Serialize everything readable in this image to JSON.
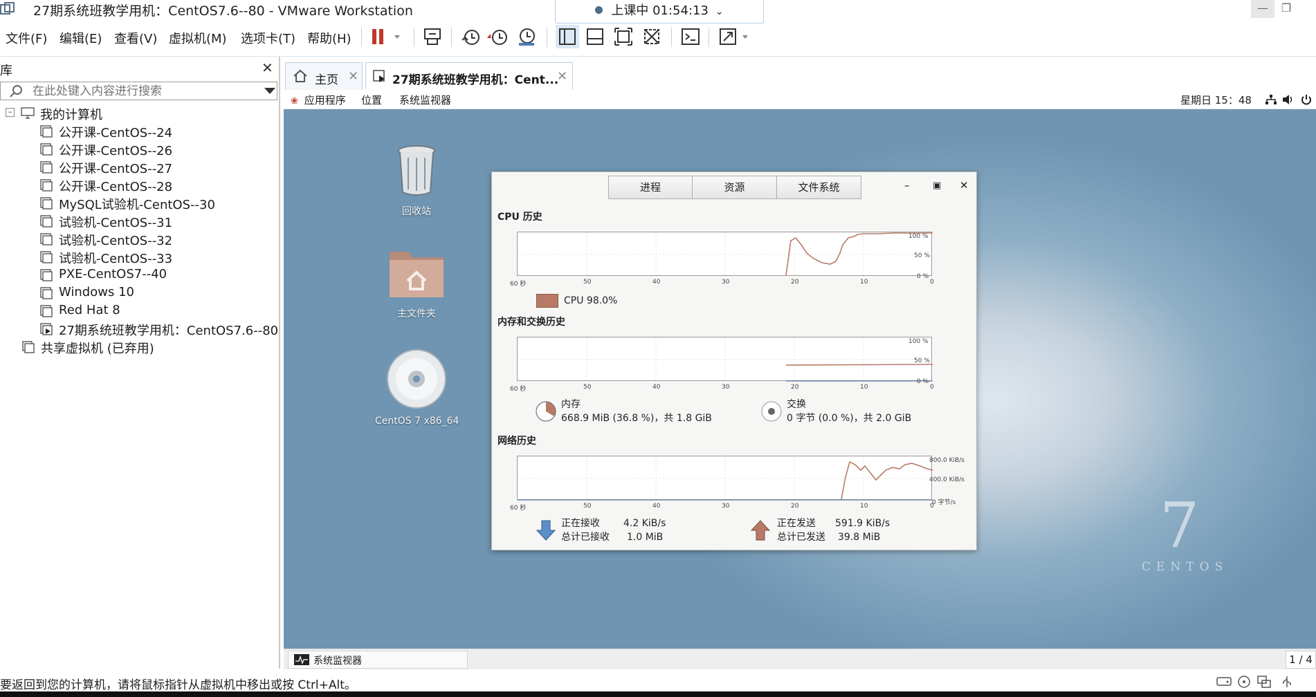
{
  "window": {
    "title": "27期系统班教学用机：CentOS7.6--80 - VMware Workstation",
    "class_timer": "上课中 01:54:13"
  },
  "menu": {
    "items": [
      "文件(F)",
      "编辑(E)",
      "查看(V)",
      "虚拟机(M)",
      "选项卡(T)",
      "帮助(H)"
    ]
  },
  "library": {
    "title": "库",
    "search_placeholder": "在此处键入内容进行搜索",
    "root": "我的计算机",
    "vms": [
      "公开课-CentOS--24",
      "公开课-CentOS--26",
      "公开课-CentOS--27",
      "公开课-CentOS--28",
      "MySQL试验机-CentOS--30",
      "试验机-CentOS--31",
      "试验机-CentOS--32",
      "试验机-CentOS--33",
      "PXE-CentOS7--40",
      "Windows 10",
      "Red Hat 8",
      "27期系统班教学用机：CentOS7.6--80"
    ],
    "shared": "共享虚拟机 (已弃用)"
  },
  "tabs": {
    "home": "主页",
    "vm": "27期系统班教学用机：Cent..."
  },
  "guest_panel": {
    "apps": "应用程序",
    "places": "位置",
    "sysmon": "系统监视器",
    "clock": "星期日 15：48"
  },
  "desktop": {
    "trash": "回收站",
    "home_folder": "主文件夹",
    "dvd": "CentOS 7 x86_64",
    "logo_number": "7",
    "logo_text": "CENTOS"
  },
  "sysmon": {
    "tabs": [
      "进程",
      "资源",
      "文件系统"
    ],
    "cpu": {
      "title": "CPU 历史",
      "legend_label": "CPU",
      "legend_value": "98.0%",
      "color": "#b87a66",
      "y_ticks": [
        "100 %",
        "50 %",
        "0 %"
      ]
    },
    "mem": {
      "title": "内存和交换历史",
      "y_ticks": [
        "100 %",
        "50 %",
        "0 %"
      ],
      "mem_label": "内存",
      "mem_detail": "668.9 MiB (36.8 %)，共 1.8 GiB",
      "swap_label": "交换",
      "swap_detail": "0 字节 (0.0 %)，共 2.0 GiB"
    },
    "net": {
      "title": "网络历史",
      "y_ticks": [
        "800.0 KiB/s",
        "400.0 KiB/s",
        "0 字节/s"
      ],
      "recv_label": "正在接收",
      "recv_value": "4.2 KiB/s",
      "recv_total_label": "总计已接收",
      "recv_total_value": "1.0 MiB",
      "send_label": "正在发送",
      "send_value": "591.9 KiB/s",
      "send_total_label": "总计已发送",
      "send_total_value": "39.8 MiB"
    },
    "x_ticks": [
      "60 秒",
      "50",
      "40",
      "30",
      "20",
      "10",
      "0"
    ]
  },
  "guest_taskbar": {
    "item": "系统监视器",
    "pager": "1 / 4"
  },
  "status": {
    "text": "要返回到您的计算机，请将鼠标指针从虚拟机中移出或按 Ctrl+Alt。"
  }
}
